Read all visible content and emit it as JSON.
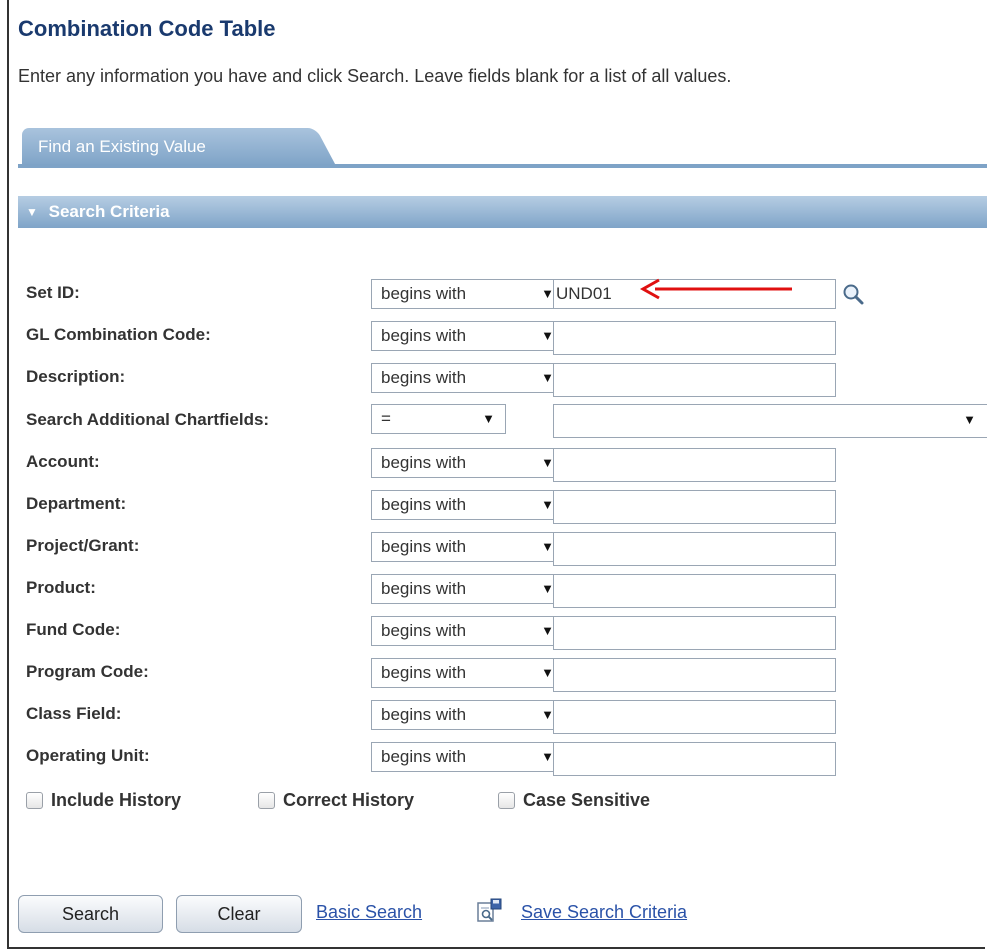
{
  "page": {
    "title": "Combination Code Table",
    "instructions": "Enter any information you have and click Search. Leave fields blank for a list of all values."
  },
  "tabs": [
    {
      "label": "Find an Existing Value"
    }
  ],
  "section": {
    "title": "Search Criteria"
  },
  "fields": [
    {
      "label": "Set ID:",
      "operator": "begins with",
      "value": "UND01"
    },
    {
      "label": "GL Combination Code:",
      "operator": "begins with",
      "value": ""
    },
    {
      "label": "Description:",
      "operator": "begins with",
      "value": ""
    },
    {
      "label": "Search Additional Chartfields:",
      "operator": "=",
      "value": ""
    },
    {
      "label": "Account:",
      "operator": "begins with",
      "value": ""
    },
    {
      "label": "Department:",
      "operator": "begins with",
      "value": ""
    },
    {
      "label": "Project/Grant:",
      "operator": "begins with",
      "value": ""
    },
    {
      "label": "Product:",
      "operator": "begins with",
      "value": ""
    },
    {
      "label": "Fund Code:",
      "operator": "begins with",
      "value": ""
    },
    {
      "label": "Program Code:",
      "operator": "begins with",
      "value": ""
    },
    {
      "label": "Class Field:",
      "operator": "begins with",
      "value": ""
    },
    {
      "label": "Operating Unit:",
      "operator": "begins with",
      "value": ""
    }
  ],
  "checkboxes": [
    {
      "label": "Include History",
      "checked": false
    },
    {
      "label": "Correct History",
      "checked": false
    },
    {
      "label": "Case Sensitive",
      "checked": false
    }
  ],
  "actions": {
    "search": "Search",
    "clear": "Clear",
    "basic_search": "Basic Search",
    "save_search": "Save Search Criteria"
  },
  "icons": {
    "dropdown": "chevron-down-icon",
    "lookup": "magnifier-icon",
    "save": "save-search-icon"
  },
  "colors": {
    "title": "#1a3a6e",
    "tab": "#7ea3c7",
    "link": "#2a52a8",
    "annotation_arrow": "#e01010"
  }
}
